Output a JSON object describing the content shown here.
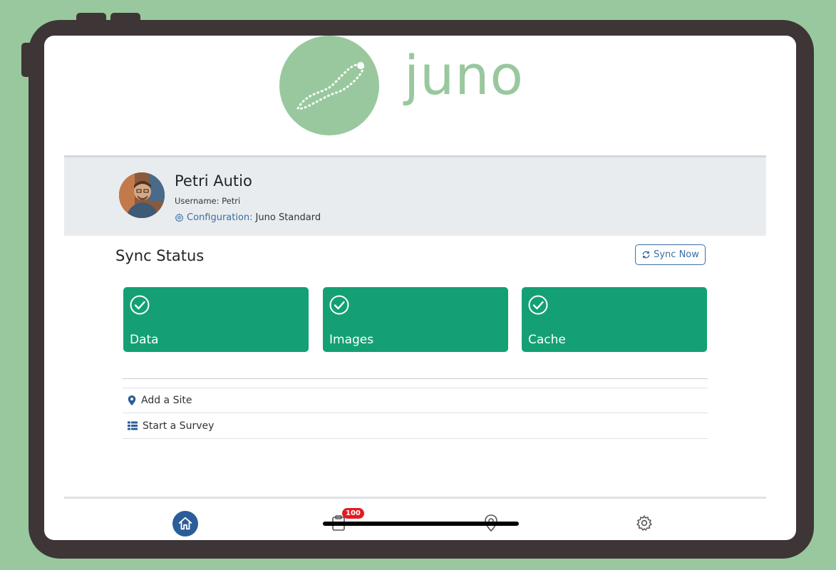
{
  "app": {
    "logo_text": "juno",
    "brand_color": "#99c89e",
    "accent_color": "#14a074"
  },
  "profile": {
    "name": "Petri Autio",
    "username_label": "Username: Petri",
    "config_label": "Configuration:",
    "config_value": "Juno Standard",
    "config_icon": "gear-icon"
  },
  "sync": {
    "title": "Sync Status",
    "button_label": "Sync Now",
    "cards": [
      {
        "label": "Data",
        "status": "check"
      },
      {
        "label": "Images",
        "status": "check"
      },
      {
        "label": "Cache",
        "status": "check"
      }
    ]
  },
  "actions": [
    {
      "label": "Add a Site",
      "icon": "map-marker-icon"
    },
    {
      "label": "Start a Survey",
      "icon": "table-list-icon"
    }
  ],
  "nav": {
    "items": [
      {
        "name": "home",
        "icon": "home-icon",
        "active": true
      },
      {
        "name": "tasks",
        "icon": "clipboard-icon",
        "badge": "100"
      },
      {
        "name": "map",
        "icon": "map-pin-icon"
      },
      {
        "name": "settings",
        "icon": "gear-icon"
      }
    ]
  }
}
